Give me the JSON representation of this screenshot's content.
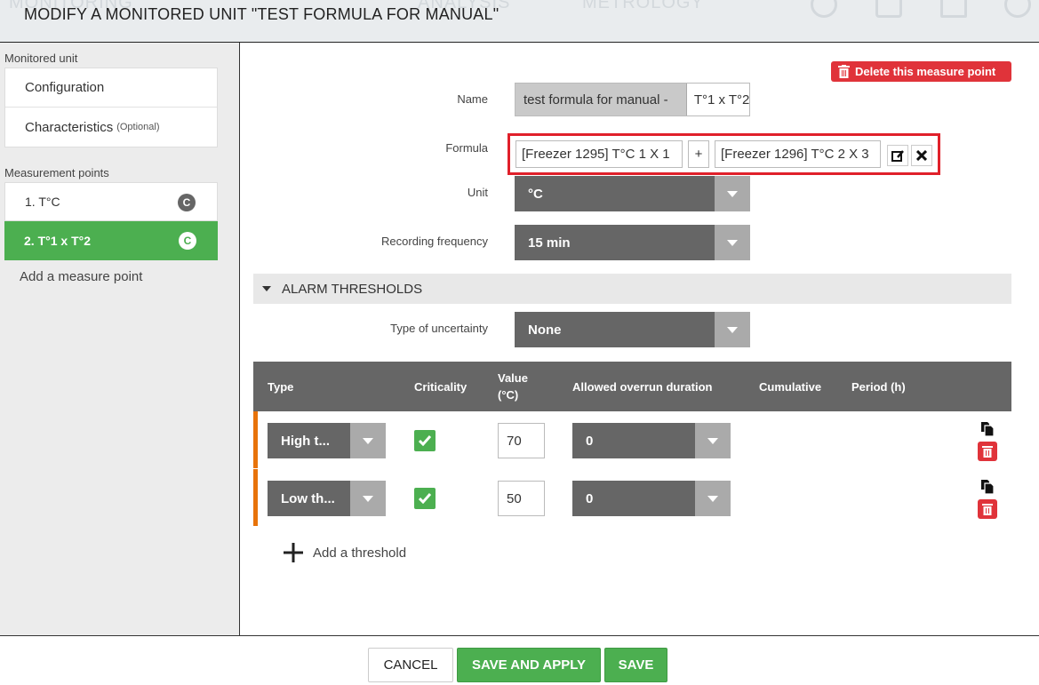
{
  "header": {
    "title": "MODIFY A MONITORED UNIT \"TEST FORMULA FOR MANUAL\"",
    "bg_tabs": [
      "MONITORING",
      "ANALYSIS",
      "METROLOGY"
    ]
  },
  "sidebar": {
    "monitored_unit_label": "Monitored unit",
    "items": [
      {
        "label": "Configuration",
        "suffix": ""
      },
      {
        "label": "Characteristics",
        "suffix": "(Optional)"
      }
    ],
    "measurement_points_label": "Measurement points",
    "measure_points": [
      {
        "label": "1. T°C",
        "badge": "C",
        "active": false
      },
      {
        "label": "2. T°1 x T°2",
        "badge": "C",
        "active": true
      }
    ],
    "add_measure_point": "Add a measure point"
  },
  "main": {
    "delete_button": "Delete this measure point",
    "name_label": "Name",
    "name_prefix": "test formula for manual -",
    "name_value": "T°1 x T°2",
    "formula_label": "Formula",
    "formula": {
      "operand1": "[Freezer 1295] T°C 1 X 1",
      "operator": "+",
      "operand2": "[Freezer 1296] T°C 2 X 3"
    },
    "unit_label": "Unit",
    "unit_value": "°C",
    "frequency_label": "Recording frequency",
    "frequency_value": "15 min",
    "alarm_section": "ALARM THRESHOLDS",
    "uncertainty_label": "Type of uncertainty",
    "uncertainty_value": "None",
    "table": {
      "columns": [
        "Type",
        "Criticality",
        "Value\n(°C)",
        "Allowed overrun duration",
        "Cumulative",
        "Period (h)"
      ],
      "rows": [
        {
          "type": "High t...",
          "criticality": true,
          "value": "70",
          "duration": "0"
        },
        {
          "type": "Low th...",
          "criticality": true,
          "value": "50",
          "duration": "0"
        }
      ]
    },
    "add_threshold": "Add a threshold"
  },
  "footer": {
    "cancel": "CANCEL",
    "save_and_apply": "SAVE AND APPLY",
    "save": "SAVE"
  },
  "colors": {
    "accent_green": "#4caf50",
    "danger_red": "#e0333a",
    "row_marker_orange": "#e8730a",
    "select_gray": "#666666"
  }
}
